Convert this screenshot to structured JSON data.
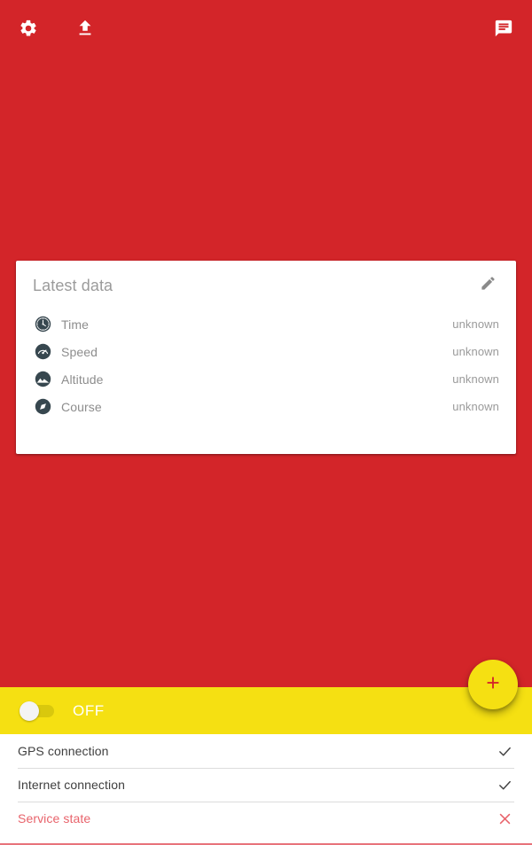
{
  "theme": {
    "primary": "#D32529",
    "accent": "#F5E012",
    "surface": "#FFFFFF",
    "alert": "#E8636B",
    "icon_dark": "#37474F"
  },
  "appbar": {
    "actions": [
      {
        "name": "settings",
        "icon": "gear-icon",
        "label": "Settings"
      },
      {
        "name": "upload",
        "icon": "upload-icon",
        "label": "Upload"
      }
    ],
    "right_actions": [
      {
        "name": "messages",
        "icon": "chat-icon",
        "label": "Messages"
      }
    ]
  },
  "card": {
    "title": "Latest data",
    "edit_icon": "pencil-icon",
    "rows": [
      {
        "icon": "clock-icon",
        "label": "Time",
        "value": "unknown"
      },
      {
        "icon": "speedometer-icon",
        "label": "Speed",
        "value": "unknown"
      },
      {
        "icon": "mountain-icon",
        "label": "Altitude",
        "value": "unknown"
      },
      {
        "icon": "compass-icon",
        "label": "Course",
        "value": "unknown"
      }
    ]
  },
  "toggle_bar": {
    "state_label": "OFF",
    "checked": false
  },
  "fab": {
    "icon": "plus-icon",
    "label": "Add"
  },
  "status_list": {
    "rows": [
      {
        "label": "GPS connection",
        "mark": "check",
        "alert": false
      },
      {
        "label": "Internet connection",
        "mark": "check",
        "alert": false
      },
      {
        "label": "Service state",
        "mark": "cross",
        "alert": true
      }
    ]
  }
}
